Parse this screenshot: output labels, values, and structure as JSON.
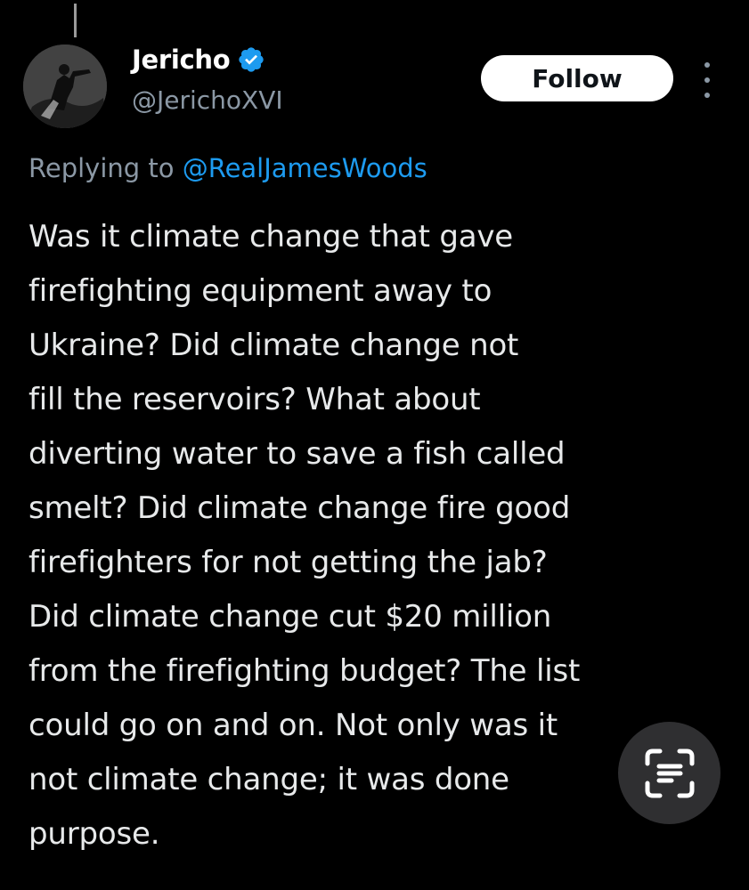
{
  "author": {
    "display_name": "Jericho",
    "handle": "@JerichoXVI",
    "verified": true,
    "verified_color": "#1d9bf0"
  },
  "actions": {
    "follow_label": "Follow",
    "more_icon": "more-vertical-icon"
  },
  "reply": {
    "prefix": "Replying to",
    "mention": "@RealJamesWoods"
  },
  "tweet": {
    "lines": [
      "Was it climate change that gave",
      "firefighting equipment away to",
      "Ukraine? Did climate change not",
      "fill the reservoirs? What about",
      "diverting water to save a fish called",
      "smelt? Did climate change fire good",
      "firefighters for not getting the jab?",
      "Did climate change cut $20 million",
      "from the firefighting budget? The list",
      "could go on and on. Not only was it",
      "not climate change; it was done",
      "purpose."
    ]
  },
  "overlay": {
    "lens_icon": "text-scan-icon"
  },
  "colors": {
    "background": "#000000",
    "text": "#e7e9ea",
    "secondary": "#8b98a5",
    "link": "#1d9bf0"
  }
}
